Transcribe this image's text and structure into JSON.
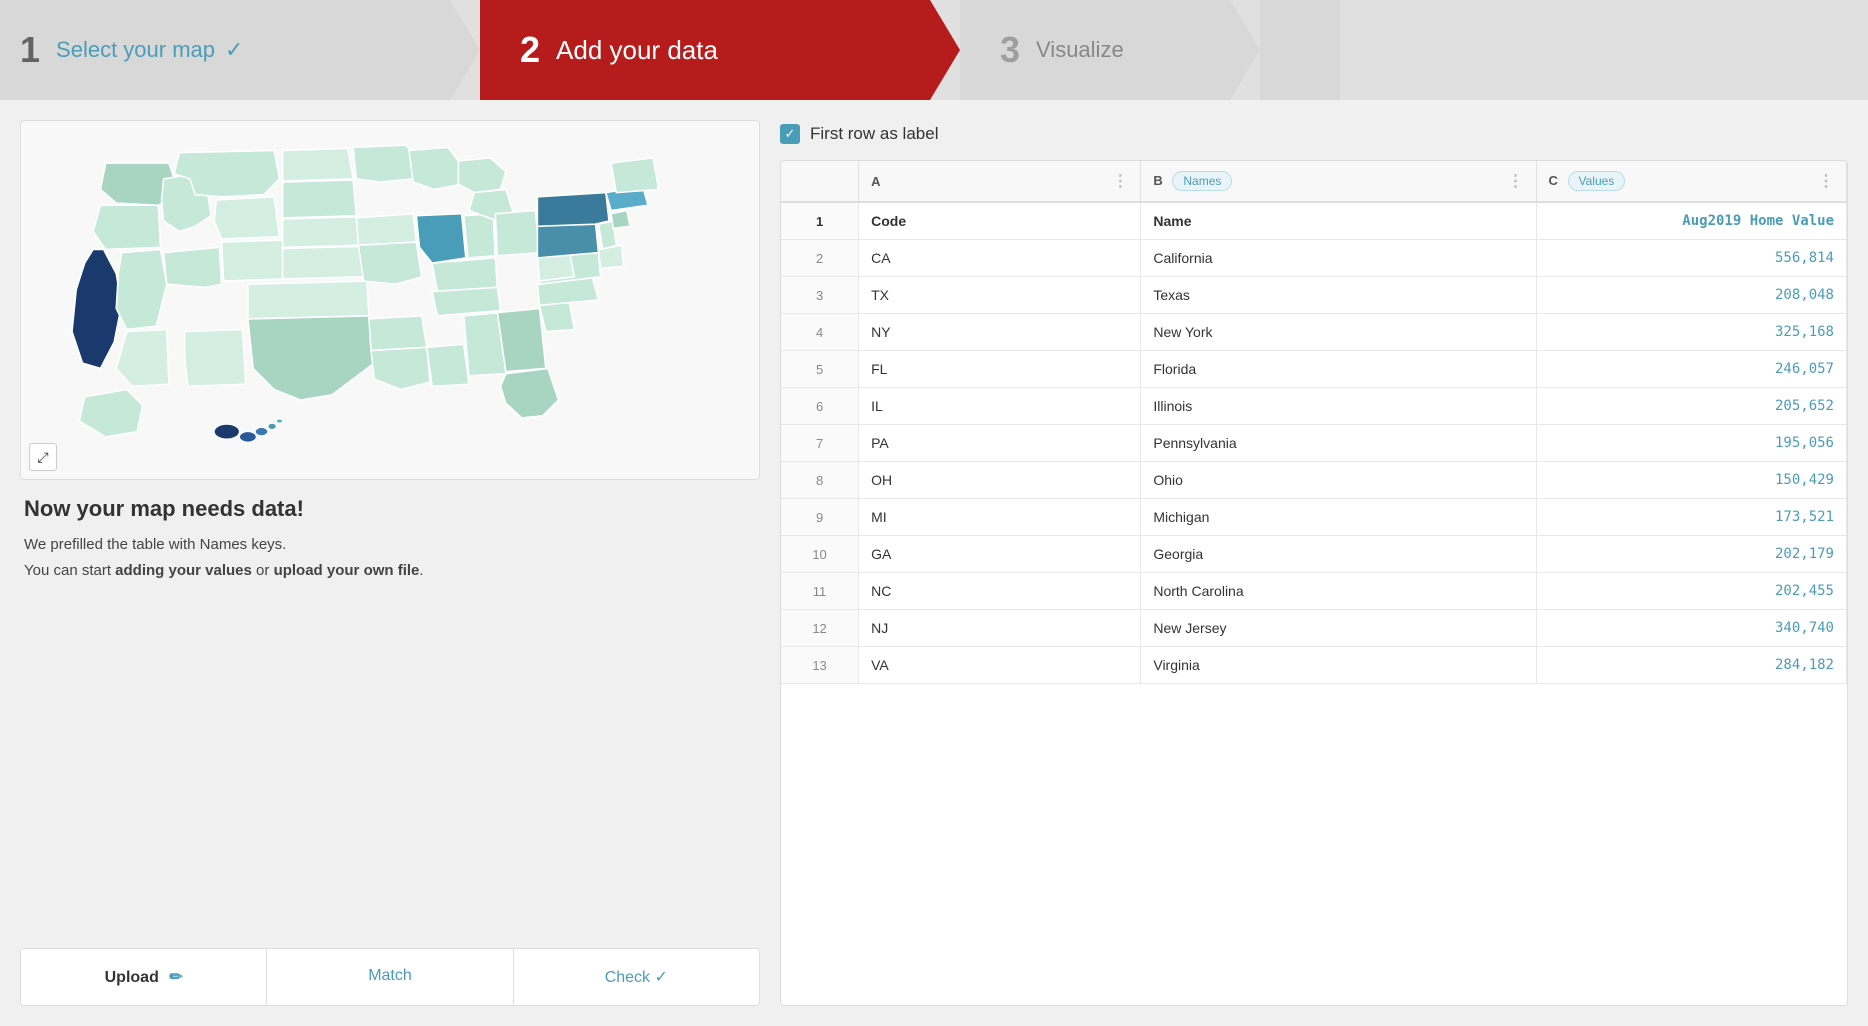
{
  "steps": [
    {
      "number": "1",
      "label": "Select your map",
      "check": "✓",
      "state": "inactive"
    },
    {
      "number": "2",
      "label": "Add your data",
      "state": "active"
    },
    {
      "number": "3",
      "label": "Visualize",
      "state": "inactive3"
    }
  ],
  "map": {
    "expand_icon": "⤢"
  },
  "info": {
    "title": "Now your map needs data!",
    "line1": "We prefilled the table with Names keys.",
    "line2_pre": "You can start ",
    "line2_bold1": "adding your values",
    "line2_mid": " or ",
    "line2_bold2": "upload your own file",
    "line2_end": "."
  },
  "tabs": [
    {
      "label": "Upload",
      "icon": "✏",
      "active": true
    },
    {
      "label": "Match",
      "active": false
    },
    {
      "label": "Check",
      "check": "✓",
      "active": false
    }
  ],
  "first_row_label": {
    "label": "First row as label",
    "checked": true
  },
  "table": {
    "columns": [
      {
        "id": "row_num",
        "label": ""
      },
      {
        "id": "A",
        "label": "A",
        "badge": null
      },
      {
        "id": "B",
        "label": "B",
        "badge": "Names"
      },
      {
        "id": "C",
        "label": "C",
        "badge": "Values"
      }
    ],
    "rows": [
      {
        "num": "1",
        "A": "Code",
        "B": "Name",
        "C": "Aug2019 Home Value",
        "is_header": true
      },
      {
        "num": "2",
        "A": "CA",
        "B": "California",
        "C": "556,814"
      },
      {
        "num": "3",
        "A": "TX",
        "B": "Texas",
        "C": "208,048"
      },
      {
        "num": "4",
        "A": "NY",
        "B": "New York",
        "C": "325,168"
      },
      {
        "num": "5",
        "A": "FL",
        "B": "Florida",
        "C": "246,057"
      },
      {
        "num": "6",
        "A": "IL",
        "B": "Illinois",
        "C": "205,652"
      },
      {
        "num": "7",
        "A": "PA",
        "B": "Pennsylvania",
        "C": "195,056"
      },
      {
        "num": "8",
        "A": "OH",
        "B": "Ohio",
        "C": "150,429"
      },
      {
        "num": "9",
        "A": "MI",
        "B": "Michigan",
        "C": "173,521"
      },
      {
        "num": "10",
        "A": "GA",
        "B": "Georgia",
        "C": "202,179"
      },
      {
        "num": "11",
        "A": "NC",
        "B": "North Carolina",
        "C": "202,455"
      },
      {
        "num": "12",
        "A": "NJ",
        "B": "New Jersey",
        "C": "340,740"
      },
      {
        "num": "13",
        "A": "VA",
        "B": "Virginia",
        "C": "284,182"
      }
    ]
  }
}
